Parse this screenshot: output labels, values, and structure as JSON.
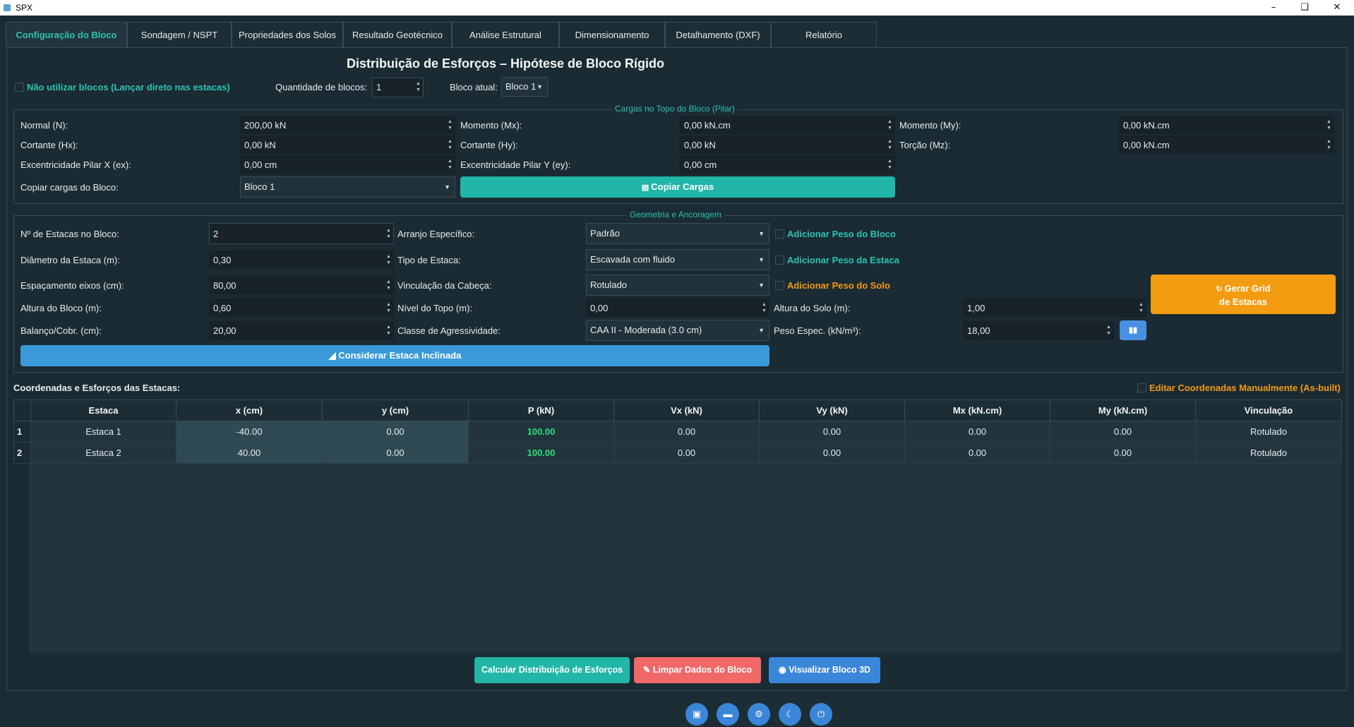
{
  "window": {
    "title": "SPX"
  },
  "tabs": [
    "Configuração do Bloco",
    "Sondagem / NSPT",
    "Propriedades dos Solos",
    "Resultado Geotécnico",
    "Análise Estrutural",
    "Dimensionamento",
    "Detalhamento (DXF)",
    "Relatório"
  ],
  "heading": "Distribuição de Esforços – Hipótese de Bloco Rígido",
  "top": {
    "no_blocks_label": "Não utilizar blocos (Lançar direto nas estacas)",
    "qty_label": "Quantidade de blocos:",
    "qty_value": "1",
    "current_label": "Bloco atual:",
    "current_value": "Bloco 1"
  },
  "loads": {
    "title": "Cargas no Topo do Bloco (Pilar)",
    "normal_label": "Normal (N):",
    "normal": "200,00 kN",
    "mx_label": "Momento (Mx):",
    "mx": "0,00 kN.cm",
    "my_label": "Momento (My):",
    "my": "0,00 kN.cm",
    "hx_label": "Cortante (Hx):",
    "hx": "0,00 kN",
    "hy_label": "Cortante (Hy):",
    "hy": "0,00 kN",
    "mz_label": "Torção (Mz):",
    "mz": "0,00 kN.cm",
    "ex_label": "Excentricidade Pilar X (ex):",
    "ex": "0,00 cm",
    "ey_label": "Excentricidade Pilar Y (ey):",
    "ey": "0,00 cm",
    "copy_label": "Copiar cargas do Bloco:",
    "copy_value": "Bloco 1",
    "copy_button": "Copiar Cargas"
  },
  "geometry": {
    "title": "Geometria e Ancoragem",
    "n_label": "Nº de Estacas no Bloco:",
    "n": "2",
    "diam_label": "Diâmetro da Estaca (m):",
    "diam": "0,30",
    "esp_label": "Espaçamento eixos (cm):",
    "esp": "80,00",
    "alt_label": "Altura do Bloco (m):",
    "alt": "0,60",
    "bal_label": "Balanço/Cobr. (cm):",
    "bal": "20,00",
    "arr_label": "Arranjo Específico:",
    "arr": "Padrão",
    "tipo_label": "Tipo de Estaca:",
    "tipo": "Escavada com fluido",
    "vinc_label": "Vinculação da Cabeça:",
    "vinc": "Rotulado",
    "nivel_label": "Nível do Topo (m):",
    "nivel": "0,00",
    "classe_label": "Classe de Agressividade:",
    "classe": "CAA II - Moderada (3.0 cm)",
    "peso_bloco": "Adicionar Peso do Bloco",
    "peso_estaca": "Adicionar Peso da Estaca",
    "peso_solo": "Adicionar Peso do Solo",
    "alt_solo_label": "Altura do Solo (m):",
    "alt_solo": "1,00",
    "peso_esp_label": "Peso Espec. (kN/m³):",
    "peso_esp": "18,00",
    "grid_button_1": "Gerar Grid",
    "grid_button_2": "de Estacas",
    "inclinada_button": "Considerar Estaca Inclinada"
  },
  "coords": {
    "title": "Coordenadas e Esforços das Estacas:",
    "edit_label": "Editar Coordenadas Manualmente (As-built)",
    "headers": [
      "Estaca",
      "x (cm)",
      "y (cm)",
      "P (kN)",
      "Vx (kN)",
      "Vy (kN)",
      "Mx (kN.cm)",
      "My (kN.cm)",
      "Vinculação"
    ],
    "rows": [
      {
        "n": "1",
        "cells": [
          "Estaca 1",
          "-40.00",
          "0.00",
          "100.00",
          "0.00",
          "0.00",
          "0.00",
          "0.00",
          "Rotulado"
        ]
      },
      {
        "n": "2",
        "cells": [
          "Estaca 2",
          "40.00",
          "0.00",
          "100.00",
          "0.00",
          "0.00",
          "0.00",
          "0.00",
          "Rotulado"
        ]
      }
    ]
  },
  "actions": {
    "calc": "Calcular Distribuição de Esforços",
    "clear": "Limpar Dados do Bloco",
    "view3d": "Visualizar Bloco 3D"
  },
  "colors": {
    "accent": "#2cc3b2",
    "orange": "#f29b12",
    "blue": "#3a9ad9",
    "red": "#f06868",
    "background": "#1b2b33"
  }
}
